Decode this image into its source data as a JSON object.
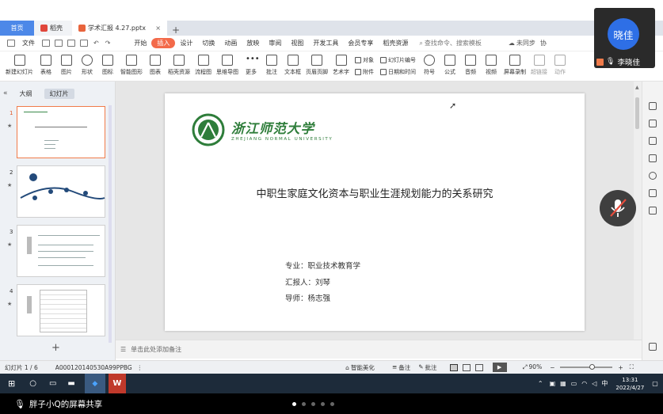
{
  "tabs": {
    "home": "首页",
    "doc": "稻壳",
    "active": "学术汇报 4.27.pptx",
    "add": "+"
  },
  "menus": [
    "文件",
    "开始",
    "插入",
    "设计",
    "切换",
    "动画",
    "放映",
    "审阅",
    "视图",
    "开发工具",
    "会员专享",
    "稻壳资源"
  ],
  "search_placeholder": "查找命令、搜索模板",
  "menu_right": [
    "未同步",
    "协"
  ],
  "ribbon": [
    {
      "label": "新建幻灯片",
      "icon": "new-slide-icon"
    },
    {
      "label": "表格",
      "icon": "table-icon"
    },
    {
      "label": "图片",
      "icon": "picture-icon"
    },
    {
      "label": "形状",
      "icon": "shape-icon"
    },
    {
      "label": "图标",
      "icon": "icons-icon"
    },
    {
      "label": "智能图形",
      "icon": "smartart-icon"
    },
    {
      "label": "图表",
      "icon": "chart-icon"
    },
    {
      "label": "稻壳资源",
      "icon": "resource-icon"
    },
    {
      "label": "流程图",
      "icon": "flowchart-icon"
    },
    {
      "label": "思维导图",
      "icon": "mindmap-icon"
    },
    {
      "label": "更多",
      "icon": "more-icon"
    },
    {
      "label": "批注",
      "icon": "comment-icon"
    },
    {
      "label": "文本框",
      "icon": "textbox-icon"
    },
    {
      "label": "页眉页脚",
      "icon": "header-footer-icon"
    },
    {
      "label": "艺术字",
      "icon": "wordart-icon"
    }
  ],
  "ribbon_small": [
    [
      "对象",
      "附件"
    ],
    [
      "幻灯片编号",
      "日期和时间"
    ]
  ],
  "ribbon_right": [
    {
      "label": "符号",
      "icon": "symbol-icon"
    },
    {
      "label": "公式",
      "icon": "formula-icon"
    },
    {
      "label": "音频",
      "icon": "audio-icon"
    },
    {
      "label": "视频",
      "icon": "video-icon"
    },
    {
      "label": "屏幕录制",
      "icon": "screen-record-icon"
    },
    {
      "label": "超链接",
      "icon": "hyperlink-icon"
    },
    {
      "label": "动作",
      "icon": "action-icon"
    }
  ],
  "panel": {
    "outline": "大纲",
    "slides": "幻灯片"
  },
  "thumbs": [
    {
      "num": "1",
      "star": "★"
    },
    {
      "num": "2",
      "star": "★"
    },
    {
      "num": "3",
      "star": "★"
    },
    {
      "num": "4",
      "star": "★"
    }
  ],
  "add_slide": "+",
  "slide": {
    "logo_cn": "浙江师范大学",
    "logo_en": "ZHEJIANG NORMAL UNIVERSITY",
    "title": "中职生家庭文化资本与职业生涯规划能力的关系研究",
    "info": [
      "专业：职业技术教育学",
      "汇报人：刘琴",
      "导师：杨志强"
    ]
  },
  "notes": "单击此处添加备注",
  "status": {
    "slide_count": "幻灯片 1 / 6",
    "doc_id": "A000120140530A99PPBG",
    "beautify": "智能美化",
    "note_btn": "备注",
    "comment_btn": "批注",
    "zoom": "90%",
    "zoom_level": 0.62
  },
  "taskbar": {
    "time": "13:31",
    "date": "2022/4/27",
    "ime": "中"
  },
  "share_text": "胖子小Q的屏幕共享",
  "pager_dots": 5,
  "avatar": {
    "initials": "晓佳",
    "name": "李晓佳"
  },
  "colors": {
    "accent": "#4d88e8",
    "insert": "#f36a4a",
    "logo": "#2e7d3a",
    "avatar": "#2e6fe6"
  }
}
